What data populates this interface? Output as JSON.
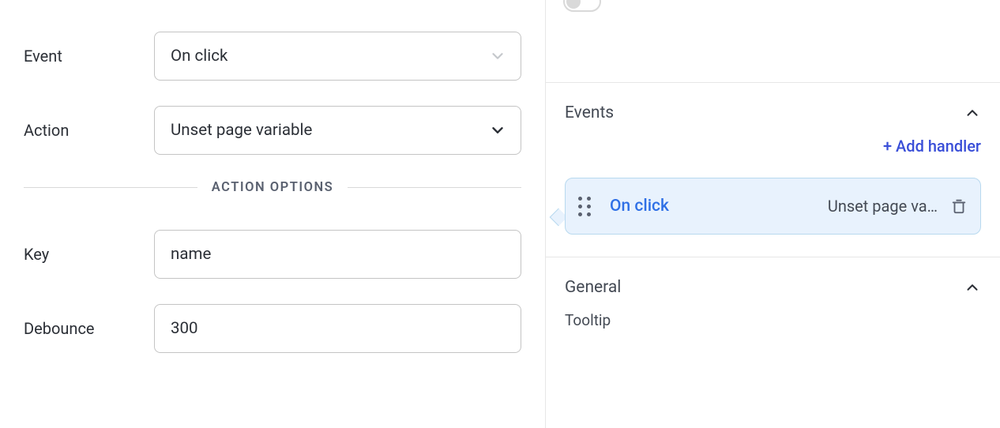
{
  "left": {
    "fields": {
      "event_label": "Event",
      "event_value": "On click",
      "action_label": "Action",
      "action_value": "Unset page variable",
      "divider_label": "ACTION OPTIONS",
      "key_label": "Key",
      "key_value": "name",
      "debounce_label": "Debounce",
      "debounce_value": "300"
    }
  },
  "right": {
    "events_section_title": "Events",
    "add_handler_label": "+ Add handler",
    "handler": {
      "event": "On click",
      "action": "Unset page va…"
    },
    "general_section_title": "General",
    "tooltip_label": "Tooltip"
  }
}
